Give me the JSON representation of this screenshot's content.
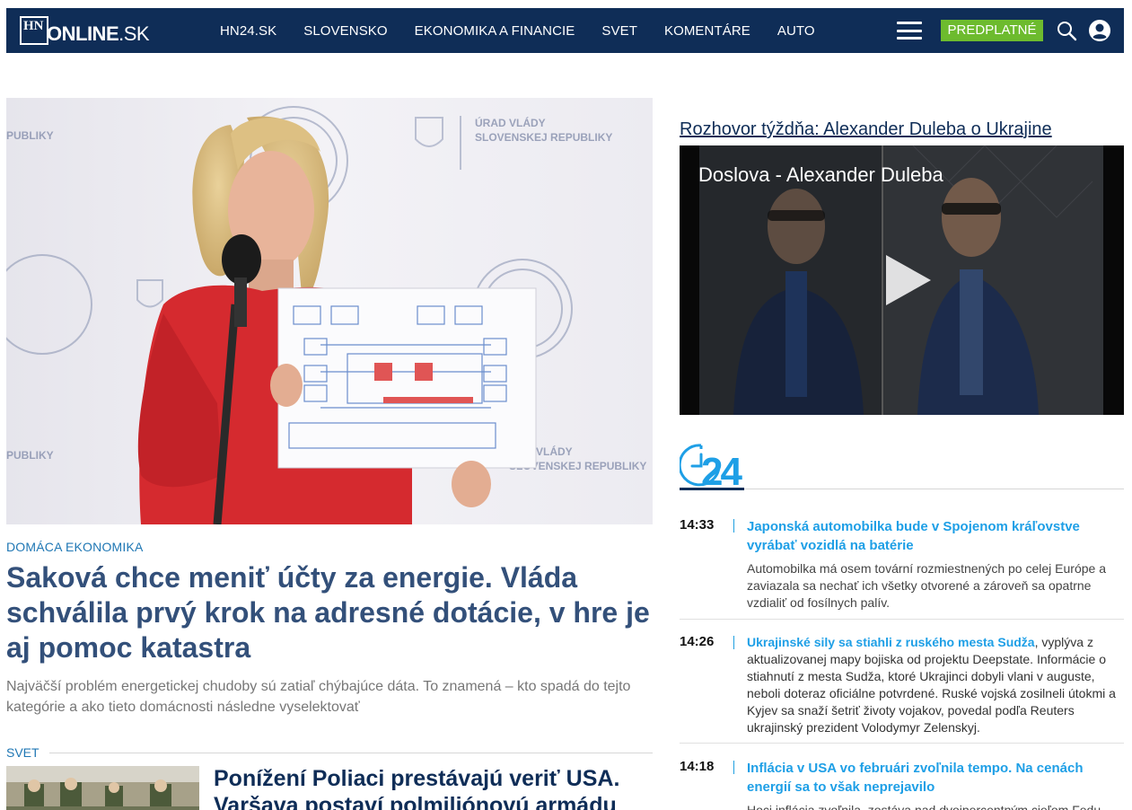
{
  "header": {
    "logo_hn": "HN",
    "logo_main": "ONLINE",
    "logo_suffix": ".SK",
    "nav": [
      "HN24.SK",
      "SLOVENSKO",
      "EKONOMIKA A FINANCIE",
      "SVET",
      "KOMENTÁRE",
      "AUTO"
    ],
    "subscribe_label": "PREDPLATNÉ",
    "menu_icon": "hamburger-icon",
    "search_icon": "search-icon",
    "user_icon": "user-icon"
  },
  "hero": {
    "category": "DOMÁCA EKONOMIKA",
    "title": "Saková chce meniť účty za energie. Vláda schválila prvý krok na adresné dotácie, v hre je aj pomoc katastra",
    "perex": "Najväčší problém energetickej chudoby sú zatiaľ chýbajúce dáta. To znamená – kto spadá do tejto kategórie a ako tieto domácnosti následne vyselektovať",
    "image_texts": {
      "top": [
        "ÚRAD VLÁDY",
        "SLOVENSKEJ REPUBLIKY"
      ],
      "bottom": [
        "VLÁDY",
        "SLOVENSKEJ REPUBLIKY"
      ],
      "left_top": "PUBLIKY",
      "left_bottom": "PUBLIKY"
    }
  },
  "section2": {
    "label": "SVET",
    "title": "Ponížení Poliaci prestávajú veriť USA. Varšava postaví polmiliónovú armádu"
  },
  "sidebar": {
    "interview_link": "Rozhovor týždňa: Alexander Duleba o Ukrajine",
    "video_title": "Doslova - Alexander Duleba",
    "play_icon": "play-icon",
    "live_logo_number": "24",
    "live_logo_icon": "clock-icon"
  },
  "news": [
    {
      "time": "14:33",
      "headline": "Japonská automobilka bude v Spojenom kráľovstve vyrábať vozidlá na batérie",
      "text": "Automobilka má osem tovární rozmiestnených po celej Európe a zaviazala sa nechať ich všetky otvorené a zároveň sa opatrne vzdialiť od fosílnych palív."
    },
    {
      "time": "14:26",
      "headline": "Ukrajinské sily sa stiahli z ruského mesta Sudža",
      "text": ", vyplýva z aktualizovanej mapy bojiska od projektu Deepstate. Informácie o stiahnutí z mesta Sudža, ktoré Ukrajinci dobyli vlani v auguste, neboli doteraz oficiálne potvrdené. Ruské vojská zosilneli útokmi a Kyjev sa snaží šetriť životy vojakov, povedal podľa Reuters ukrajinský prezident Volodymyr Zelenskyj."
    },
    {
      "time": "14:18",
      "headline": "Inflácia v USA vo februári zvoľnila tempo. Na cenách energií sa to však neprejavilo",
      "text": "Hoci inflácia zvoľnila, zostáva nad dvojpercentným cieľom Fedu."
    }
  ]
}
